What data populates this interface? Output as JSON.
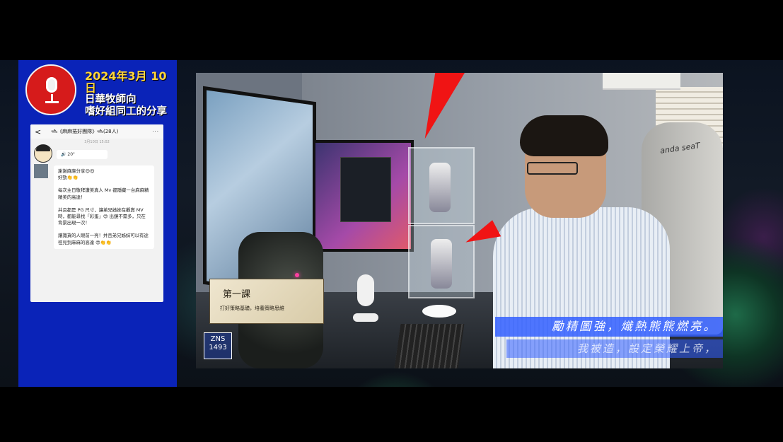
{
  "panel": {
    "title_date": "2024年3月 10日",
    "title_line2": "日華牧師向",
    "title_line3": "嗜好組同工的分享"
  },
  "chat": {
    "back_symbol": "<",
    "group_name": "🛥《麻麻捲好團隊》🛥(28人)",
    "more_symbol": "···",
    "timestamp": "3月10日 15:02",
    "voice_message": "🔊 20\"",
    "message_lines": [
      "謝謝麻麻分享😍😍",
      "好勁👏👏"
    ],
    "message_p2": "每次主日敬拜讚美真人 Mv 都隱藏一台麻麻精精美的高達！",
    "message_p3": "并且都是 PG 尺寸，讓弟兄姊妹在觀賞 MV 時，都能尋找「彩蛋」😍 出鏡不需多，只在背景出現一次！",
    "message_p4": "讓識貨的人眼前一亮！并且弟兄姊妹可以有途徑見到麻麻的高達 😍👏👏"
  },
  "video": {
    "lesson_title": "第一課",
    "lesson_subtitle": "打好策略基礎，培養策略思維",
    "chair_brand": "anda seaT",
    "badge_line1": "ZNS",
    "badge_line2": "1493",
    "subtitle_1": "勵精圖強，熾熱熊熊燃亮。",
    "subtitle_2": "我被造，設定榮耀上帝，"
  },
  "colors": {
    "panel_blue": "#0a23b8",
    "logo_red": "#d61b1b",
    "arrow_red": "#f01414",
    "subtitle_blue": "#325fff",
    "date_yellow": "#ffd53d"
  }
}
